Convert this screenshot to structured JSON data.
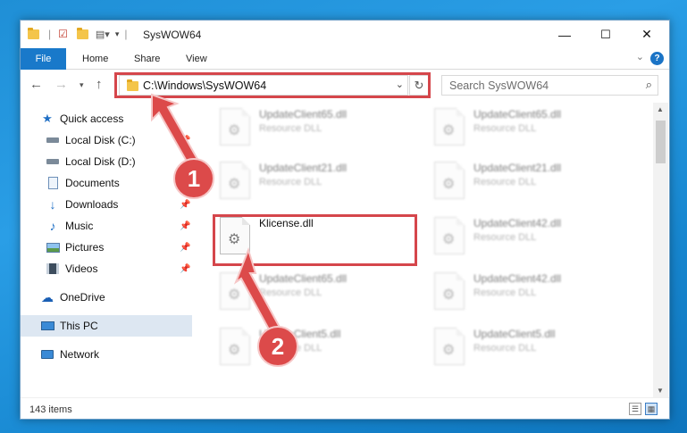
{
  "window": {
    "title": "SysWOW64",
    "controls": {
      "minimize": "—",
      "maximize": "☐",
      "close": "✕"
    }
  },
  "ribbon": {
    "tabs": [
      "File",
      "Home",
      "Share",
      "View"
    ],
    "help": "?"
  },
  "navbar": {
    "address": "C:\\Windows\\SysWOW64",
    "search_placeholder": "Search SysWOW64"
  },
  "sidebar": {
    "items": [
      {
        "label": "Quick access",
        "icon": "star-icon"
      },
      {
        "label": "Local Disk (C:)",
        "icon": "drive-icon",
        "pinned": true
      },
      {
        "label": "Local Disk (D:)",
        "icon": "drive-icon"
      },
      {
        "label": "Documents",
        "icon": "documents-icon"
      },
      {
        "label": "Downloads",
        "icon": "download-icon",
        "pinned": true
      },
      {
        "label": "Music",
        "icon": "music-icon",
        "pinned": true
      },
      {
        "label": "Pictures",
        "icon": "pictures-icon",
        "pinned": true
      },
      {
        "label": "Videos",
        "icon": "videos-icon",
        "pinned": true
      },
      {
        "label": "OneDrive",
        "icon": "cloud-icon"
      },
      {
        "label": "This PC",
        "icon": "computer-icon",
        "selected": true
      },
      {
        "label": "Network",
        "icon": "network-icon"
      }
    ]
  },
  "files": [
    {
      "name": "UpdateClient65.dll",
      "type": "Resource DLL",
      "blurred": true
    },
    {
      "name": "UpdateClient65.dll",
      "type": "Resource DLL",
      "blurred": true
    },
    {
      "name": "UpdateClient21.dll",
      "type": "Resource DLL",
      "blurred": true
    },
    {
      "name": "UpdateClient21.dll",
      "type": "Resource DLL",
      "blurred": true
    },
    {
      "name": "Klicense.dll",
      "type": "",
      "blurred": false
    },
    {
      "name": "UpdateClient42.dll",
      "type": "Resource DLL",
      "blurred": true
    },
    {
      "name": "UpdateClient65.dll",
      "type": "Resource DLL",
      "blurred": true
    },
    {
      "name": "UpdateClient42.dll",
      "type": "Resource DLL",
      "blurred": true
    },
    {
      "name": "UpdateClient5.dll",
      "type": "Resource DLL",
      "blurred": true
    },
    {
      "name": "UpdateClient5.dll",
      "type": "Resource DLL",
      "blurred": true
    }
  ],
  "status": {
    "count": "143 items"
  },
  "annotations": {
    "step1": "1",
    "step2": "2",
    "color": "#d5464b"
  }
}
